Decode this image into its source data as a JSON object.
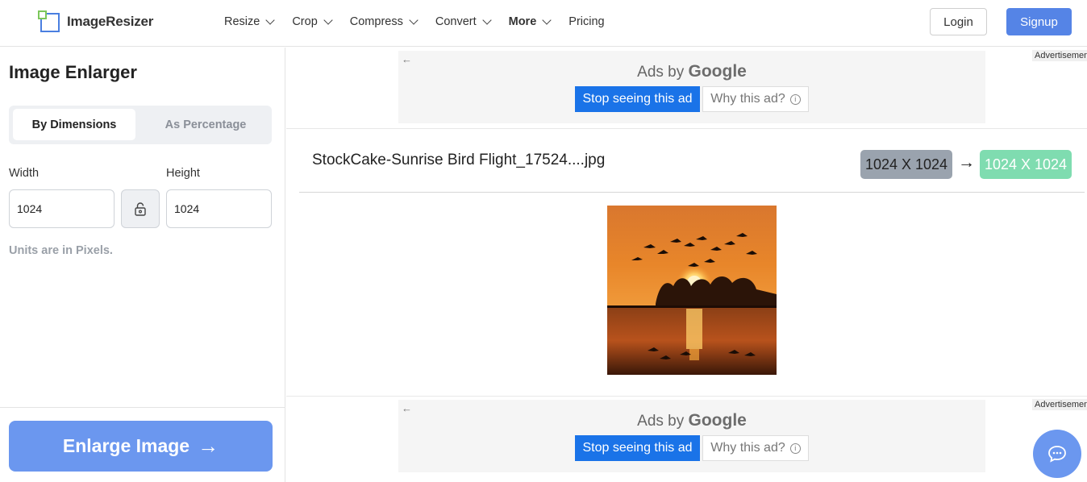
{
  "brand": {
    "name": "ImageResizer"
  },
  "nav": {
    "items": [
      {
        "label": "Resize",
        "has_dropdown": true,
        "bold": false
      },
      {
        "label": "Crop",
        "has_dropdown": true,
        "bold": false
      },
      {
        "label": "Compress",
        "has_dropdown": true,
        "bold": false
      },
      {
        "label": "Convert",
        "has_dropdown": true,
        "bold": false
      },
      {
        "label": "More",
        "has_dropdown": true,
        "bold": true
      },
      {
        "label": "Pricing",
        "has_dropdown": false,
        "bold": false
      }
    ],
    "login_label": "Login",
    "signup_label": "Signup"
  },
  "panel": {
    "title": "Image Enlarger",
    "tabs": [
      {
        "label": "By Dimensions",
        "active": true
      },
      {
        "label": "As Percentage",
        "active": false
      }
    ],
    "width_label": "Width",
    "height_label": "Height",
    "width_value": "1024",
    "height_value": "1024",
    "lock_icon": "lock-icon",
    "units_note": "Units are in Pixels.",
    "action_label": "Enlarge Image",
    "action_arrow": "→"
  },
  "ads": {
    "top": {
      "ads_by": "Ads by",
      "google": "Google",
      "stop": "Stop seeing this ad",
      "why": "Why this ad?",
      "info": "i",
      "tag": "Advertisement",
      "back": "←"
    },
    "bottom": {
      "ads_by": "Ads by",
      "google": "Google",
      "stop": "Stop seeing this ad",
      "why": "Why this ad?",
      "info": "i",
      "tag": "Advertisement",
      "back": "←"
    }
  },
  "file": {
    "name": "StockCake-Sunrise Bird Flight_17524....jpg",
    "original_dims": "1024 X 1024",
    "arrow": "→",
    "new_dims": "1024 X 1024"
  },
  "colors": {
    "accent": "#5584e6",
    "action": "#6b97ef",
    "new_dims_bg": "#7fdcb0",
    "old_dims_bg": "#9aa3ae"
  },
  "icons": {
    "chat": "chat-bubble-icon",
    "nav_dropdown": "chevron-down-icon"
  }
}
